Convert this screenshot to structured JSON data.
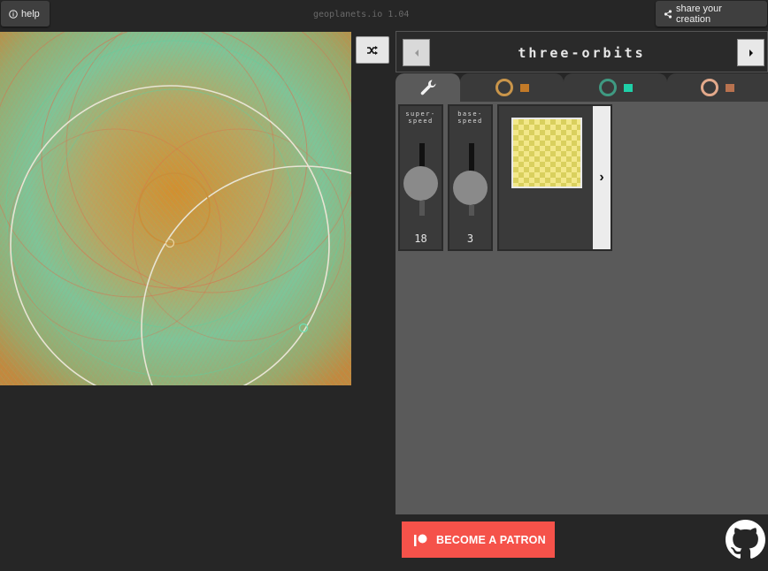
{
  "header": {
    "help_label": "help",
    "version": "geoplanets.io 1.04",
    "share_label": "share your creation"
  },
  "title": "three-orbits",
  "tabs": [
    {
      "name": "settings",
      "icon": "wrench-icon"
    },
    {
      "name": "planet-1",
      "ring_color": "#c9954a",
      "swatch_color": "#c27a28"
    },
    {
      "name": "planet-2",
      "ring_color": "#3f9a82",
      "swatch_color": "#1fd0a8"
    },
    {
      "name": "planet-3",
      "ring_color": "#e3a98b",
      "swatch_color": "#b8724f"
    }
  ],
  "controls": {
    "super_speed": {
      "label": "super-speed",
      "value": "18",
      "level": 0.45
    },
    "base_speed": {
      "label": "base-speed",
      "value": "3",
      "level": 0.39
    }
  },
  "colors": {
    "background_swatch": "#f3e88a",
    "patron_red": "#f5524a",
    "canvas_bg": "#c7a54d"
  },
  "footer": {
    "patron_label": "BECOME A PATRON"
  }
}
